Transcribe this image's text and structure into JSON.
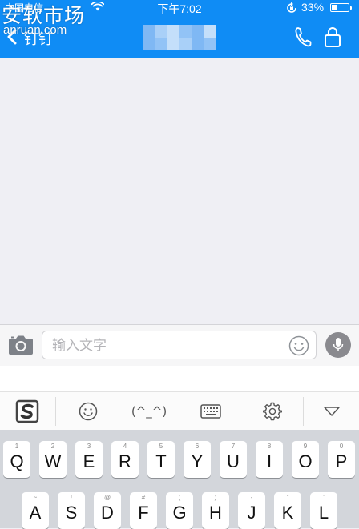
{
  "status_bar": {
    "carrier": "中国电信",
    "time": "下午7:02",
    "battery_percent": "33%",
    "battery_level": 0.33
  },
  "watermark": {
    "cn": "安软市场",
    "en": "anruan.com"
  },
  "nav": {
    "back_label": "钉钉",
    "icons": [
      "chevron-left-icon",
      "phone-icon",
      "lock-icon"
    ]
  },
  "input_bar": {
    "placeholder": "输入文字",
    "icons": [
      "camera-icon",
      "smiley-icon",
      "microphone-icon"
    ]
  },
  "ime_toolbar": {
    "kaomoji": "(^_^)",
    "icons": [
      "sogou-logo-icon",
      "smiley-icon",
      "keyboard-icon",
      "gear-icon",
      "triangle-down-icon"
    ]
  },
  "keyboard": {
    "row1": [
      {
        "label": "Q",
        "hint": "1"
      },
      {
        "label": "W",
        "hint": "2"
      },
      {
        "label": "E",
        "hint": "3"
      },
      {
        "label": "R",
        "hint": "4"
      },
      {
        "label": "T",
        "hint": "5"
      },
      {
        "label": "Y",
        "hint": "6"
      },
      {
        "label": "U",
        "hint": "7"
      },
      {
        "label": "I",
        "hint": "8"
      },
      {
        "label": "O",
        "hint": "9"
      },
      {
        "label": "P",
        "hint": "0"
      }
    ],
    "row2": [
      {
        "label": "A",
        "hint": "~"
      },
      {
        "label": "S",
        "hint": "!"
      },
      {
        "label": "D",
        "hint": "@"
      },
      {
        "label": "F",
        "hint": "#"
      },
      {
        "label": "G",
        "hint": "("
      },
      {
        "label": "H",
        "hint": ")"
      },
      {
        "label": "J",
        "hint": "-"
      },
      {
        "label": "K",
        "hint": "\""
      },
      {
        "label": "L",
        "hint": "'"
      }
    ]
  },
  "colors": {
    "brand_blue": "#0f8cf5",
    "chat_background": "#efeff4",
    "keyboard_background": "#d3d6db"
  }
}
